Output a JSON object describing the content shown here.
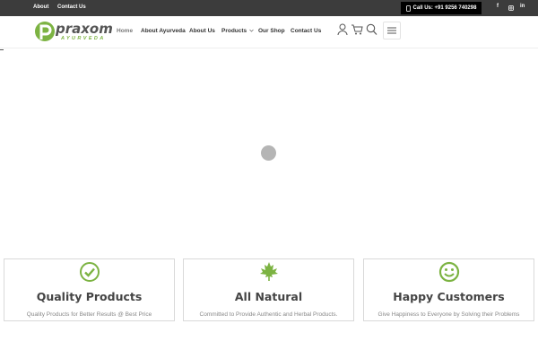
{
  "topbar": {
    "links": [
      "About",
      "Contact Us"
    ],
    "call_label": "Call Us: +91 9256 740298",
    "social": [
      "f",
      "ig",
      "in"
    ]
  },
  "header": {
    "logo_text": "praxom",
    "logo_sub": "AYURVEDA",
    "nav": [
      "Home",
      "About Ayurveda",
      "About Us",
      "Products",
      "Our Shop",
      "Contact Us"
    ]
  },
  "features": [
    {
      "icon": "check-circle-icon",
      "title": "Quality Products",
      "desc": "Quality Products for Better Results @ Best Price"
    },
    {
      "icon": "leaf-icon",
      "title": "All Natural",
      "desc": "Committed to Provide Authentic and Herbal Products."
    },
    {
      "icon": "smile-icon",
      "title": "Happy Customers",
      "desc": "Give Happiness to Everyone by Solving their Problems"
    }
  ],
  "colors": {
    "accent": "#7cb342",
    "topbar": "#3c3c3c"
  }
}
